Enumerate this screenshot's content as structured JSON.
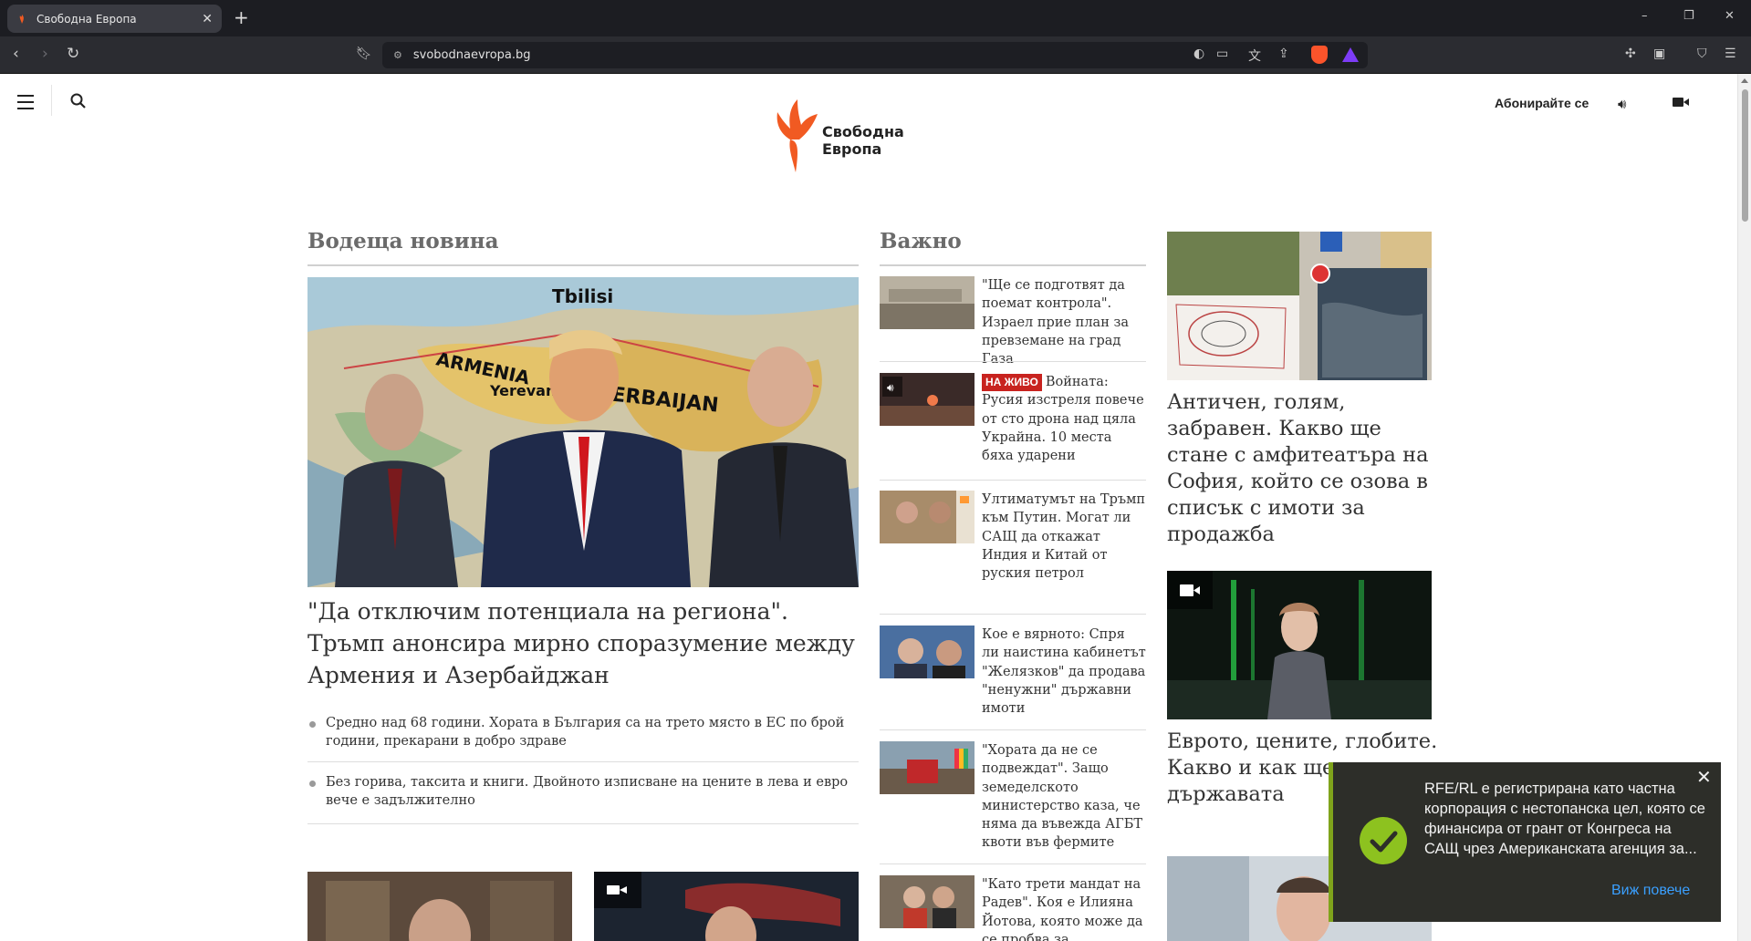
{
  "browser": {
    "tab_title": "Свободна Европа",
    "tab_close": "✕",
    "new_tab": "+",
    "url": "svobodnaevropa.bg",
    "window_controls": [
      "–",
      "❐",
      "✕"
    ]
  },
  "site": {
    "logo_line1": "Свободна",
    "logo_line2": "Европа",
    "subscribe_label": "Абонирайте се",
    "brand_color": "#f15a22"
  },
  "lead": {
    "section_title": "Водеща новина",
    "title": "\"Да отключим потенциала на региона\". Тръмп анонсира мирно споразумение между Армения и Азербайджан",
    "image_labels": [
      "Tbilisi",
      "ARMENIA",
      "Yerevan",
      "AZERBAIJAN"
    ],
    "bullets": [
      "Средно над 68 години. Хората в България са на трето място в ЕС по брой години, прекарани в добро здраве",
      "Без горива, таксита и книги. Двойното изписване на цените в лева и евро вече е задължително"
    ]
  },
  "important": {
    "section_title": "Важно",
    "live_label": "НА ЖИВО",
    "items": [
      {
        "text": "\"Ще се подготвят да поемат контрола\". Израел прие план за превземане на град Газа",
        "live": false
      },
      {
        "text": "Войната: Русия изстреля повече от сто дрона над цяла Украйна. 10 места бяха ударени",
        "live": true
      },
      {
        "text": "Ултиматумът на Тръмп към Путин. Могат ли САЩ да откажат Индия и Китай от руския петрол",
        "live": false
      },
      {
        "text": "Кое е вярното: Спря ли наистина кабинетът \"Желязков\" да продава \"ненужни\" държавни имоти",
        "live": false
      },
      {
        "text": "\"Хората да не се подвеждат\". Защо земеделското министерство каза, че няма да въвежда АГБТ квоти във фермите",
        "live": false
      },
      {
        "text": "\"Като трети мандат на Радев\". Коя е Илияна Йотова, която може да се пробва за президент",
        "live": false
      }
    ]
  },
  "right": {
    "story1_title": "Античен, голям, забравен. Какво ще стане с амфитеатъра на София, който се озова в списък с имоти за продажба",
    "story2_title": "Еврото, цените, глобите. Какво и как ще ко държавата"
  },
  "toast": {
    "text": "RFE/RL е регистрирана като частна корпорация с нестопанска цел, която се финансира от грант от Конгреса на САЩ чрез Американската агенция за...",
    "more": "Виж повече",
    "close": "✕"
  }
}
